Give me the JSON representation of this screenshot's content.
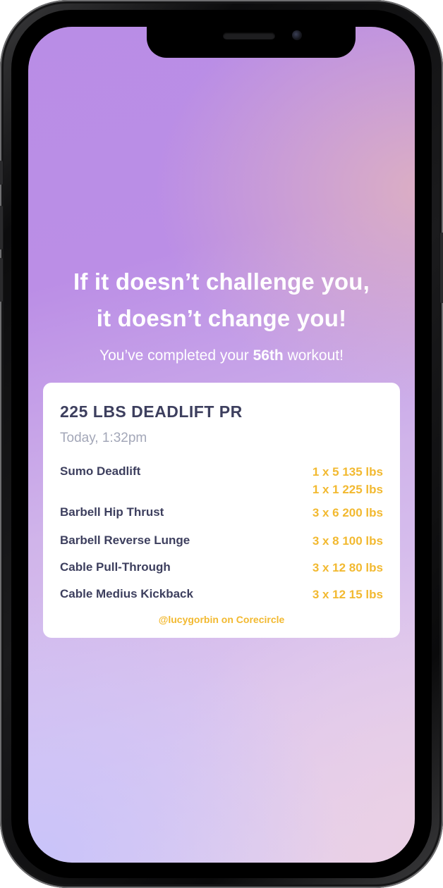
{
  "motivation": {
    "line1": "If it doesn’t challenge you,",
    "line2": "it doesn’t change you!"
  },
  "completion": {
    "prefix": "You’ve completed your ",
    "count": "56th",
    "suffix": " workout!"
  },
  "workout_card": {
    "title": "225 LBS DEADLIFT PR",
    "time": "Today, 1:32pm",
    "exercises": [
      {
        "name": "Sumo Deadlift",
        "sets": [
          "1 x 5 135 lbs",
          "1 x 1 225 lbs"
        ]
      },
      {
        "name": "Barbell Hip Thrust",
        "sets": [
          "3 x 6 200 lbs"
        ]
      },
      {
        "name": "Barbell Reverse Lunge",
        "sets": [
          "3 x 8 100 lbs"
        ]
      },
      {
        "name": "Cable Pull-Through",
        "sets": [
          "3 x 12 80 lbs"
        ]
      },
      {
        "name": "Cable Medius Kickback",
        "sets": [
          "3 x 12 15 lbs"
        ]
      }
    ],
    "credit": "@lucygorbin on Corecircle"
  },
  "colors": {
    "accent": "#f2b930",
    "text_dark": "#3d3f5e",
    "text_muted": "#a3a7b8",
    "gradient_purple": "#b98de6",
    "gradient_pink": "#e1b4be",
    "gradient_lavender": "#c8c3fa"
  }
}
